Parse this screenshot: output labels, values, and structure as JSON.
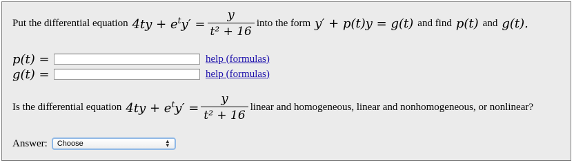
{
  "question1": {
    "prefix": "Put the differential equation",
    "eq_lhs_a": "4ty + e",
    "eq_lhs_sup": "t",
    "eq_lhs_b": "y′ =",
    "eq_num": "y",
    "eq_den": "t² + 16",
    "middle": "into the form",
    "target_form": "y′ + p(t)y = g(t)",
    "and_find": "and find",
    "p_label": "p(t)",
    "and": "and",
    "g_label_end": "g(t)."
  },
  "answers": {
    "p_label": "p(t) =",
    "g_label": "g(t) =",
    "p_value": "",
    "g_value": "",
    "help_text": "help (formulas)"
  },
  "question2": {
    "prefix": "Is the differential equation",
    "eq_lhs_a": "4ty + e",
    "eq_lhs_sup": "t",
    "eq_lhs_b": "y′ =",
    "eq_num": "y",
    "eq_den": "t² + 16",
    "suffix": "linear and homogeneous, linear and nonhomogeneous, or nonlinear?"
  },
  "answer_select": {
    "label": "Answer:",
    "selected": "Choose"
  }
}
